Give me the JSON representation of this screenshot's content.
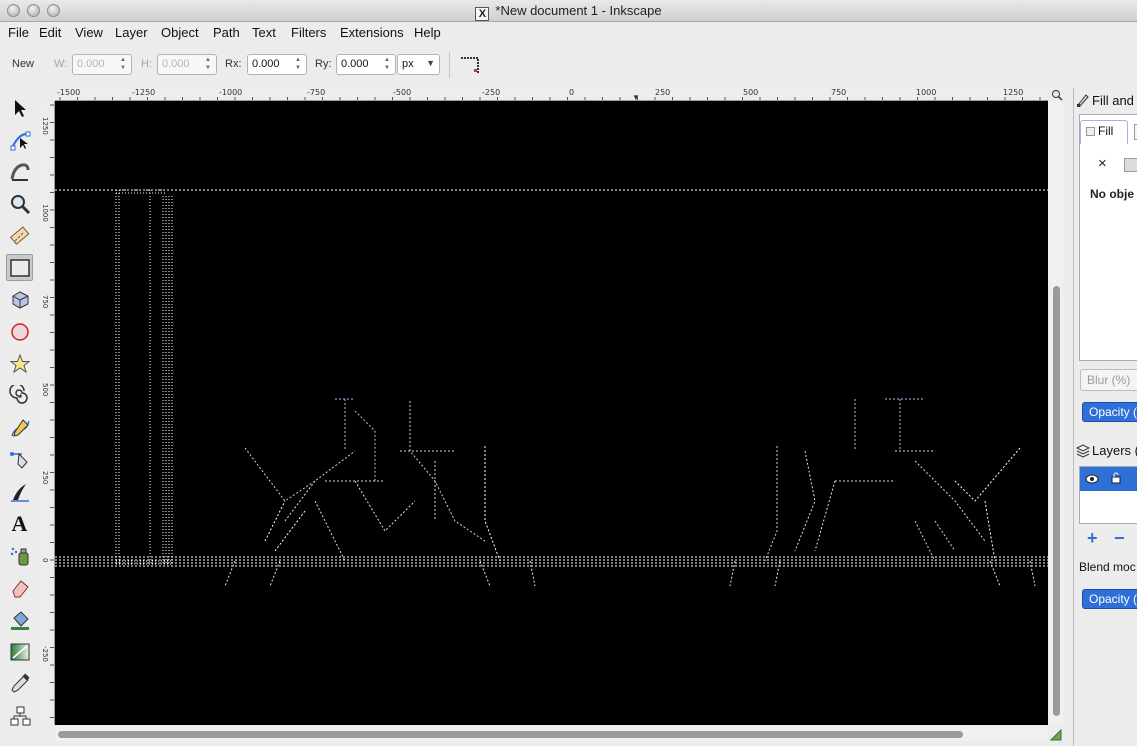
{
  "window": {
    "title": "*New document 1 - Inkscape",
    "x_logo": "X"
  },
  "menu": [
    "File",
    "Edit",
    "View",
    "Layer",
    "Object",
    "Path",
    "Text",
    "Filters",
    "Extensions",
    "Help"
  ],
  "controls": {
    "new_label": "New",
    "w_label": "W:",
    "w_value": "0.000",
    "h_label": "H:",
    "h_value": "0.000",
    "rx_label": "Rx:",
    "rx_value": "0.000",
    "ry_label": "Ry:",
    "ry_value": "0.000",
    "unit": "px"
  },
  "ruler_h": [
    "-1500",
    "-1250",
    "-1000",
    "-750",
    "-500",
    "-250",
    "0",
    "250",
    "500",
    "750",
    "1000",
    "1250"
  ],
  "ruler_v": [
    "1250",
    "1000",
    "750",
    "500",
    "250",
    "0",
    "-250"
  ],
  "tools": [
    {
      "icon": "selector-arrow-icon"
    },
    {
      "icon": "node-editor-icon"
    },
    {
      "icon": "tweak-icon"
    },
    {
      "icon": "zoom-icon"
    },
    {
      "icon": "measure-icon"
    },
    {
      "icon": "rectangle-icon",
      "active": true
    },
    {
      "icon": "3d-box-icon"
    },
    {
      "icon": "ellipse-icon"
    },
    {
      "icon": "star-icon"
    },
    {
      "icon": "spiral-icon"
    },
    {
      "icon": "pencil-icon"
    },
    {
      "icon": "pen-icon"
    },
    {
      "icon": "calligraphy-icon"
    },
    {
      "icon": "text-icon"
    },
    {
      "icon": "spray-icon"
    },
    {
      "icon": "eraser-icon"
    },
    {
      "icon": "paint-bucket-icon"
    },
    {
      "icon": "gradient-icon"
    },
    {
      "icon": "dropper-icon"
    },
    {
      "icon": "connector-icon"
    }
  ],
  "text_tool_glyph": "A",
  "dock": {
    "fill_stroke_title": "Fill and",
    "fill_tab": "Fill",
    "no_paint_glyph": "×",
    "no_object": "No obje",
    "blur_label": "Blur (%)",
    "opacity_label": "Opacity (",
    "layers_title": "Layers (",
    "add_glyph": "+",
    "remove_glyph": "−",
    "blend_label": "Blend moc",
    "layer_opacity_label": "Opacity ("
  },
  "colors": {
    "canvas": "#000000",
    "accent": "#2f6fd8",
    "dotted_lines": "#ffffff"
  }
}
